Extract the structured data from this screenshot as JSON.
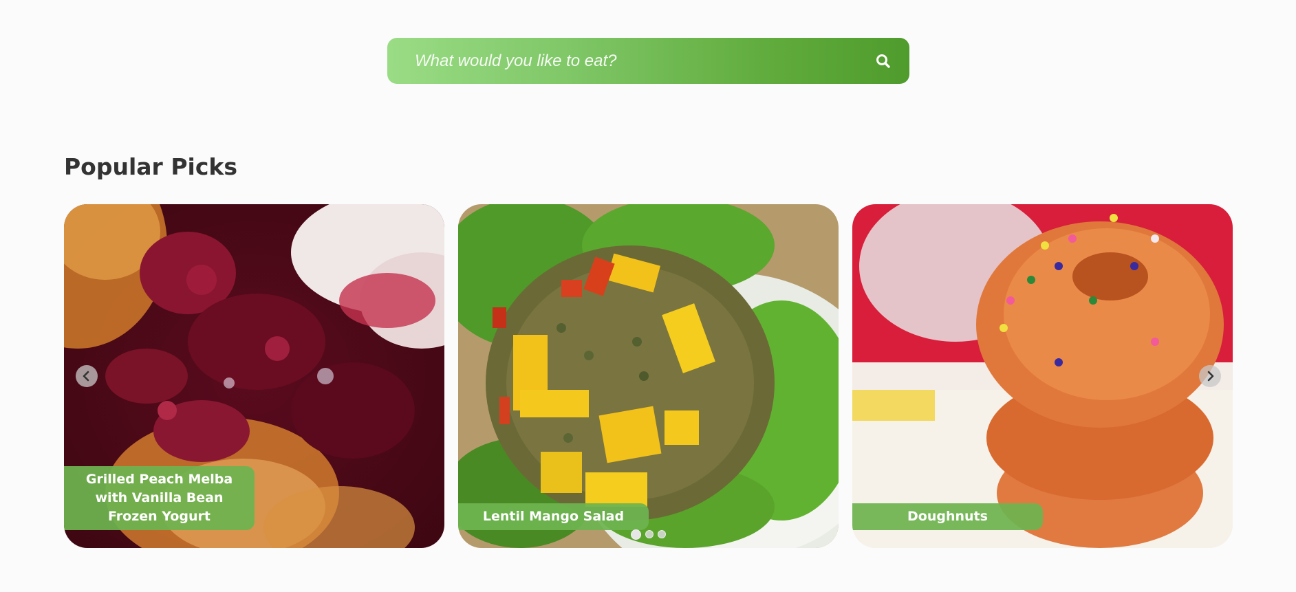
{
  "search": {
    "placeholder": "What would you like to eat?",
    "icon": "search-icon"
  },
  "section": {
    "title": "Popular Picks"
  },
  "carousel": {
    "cards": [
      {
        "title": "Grilled Peach Melba with Vanilla Bean Frozen Yogurt"
      },
      {
        "title": "Lentil Mango Salad"
      },
      {
        "title": "Doughnuts"
      }
    ],
    "prev_icon": "chevron-left-icon",
    "next_icon": "chevron-right-icon",
    "dots": 3,
    "active_dot": 1
  },
  "colors": {
    "accent_green": "#6eb450",
    "search_gradient_start": "#9adc85",
    "search_gradient_end": "#4f9b2c",
    "title_text": "#333333",
    "background": "#fbfbfb"
  }
}
